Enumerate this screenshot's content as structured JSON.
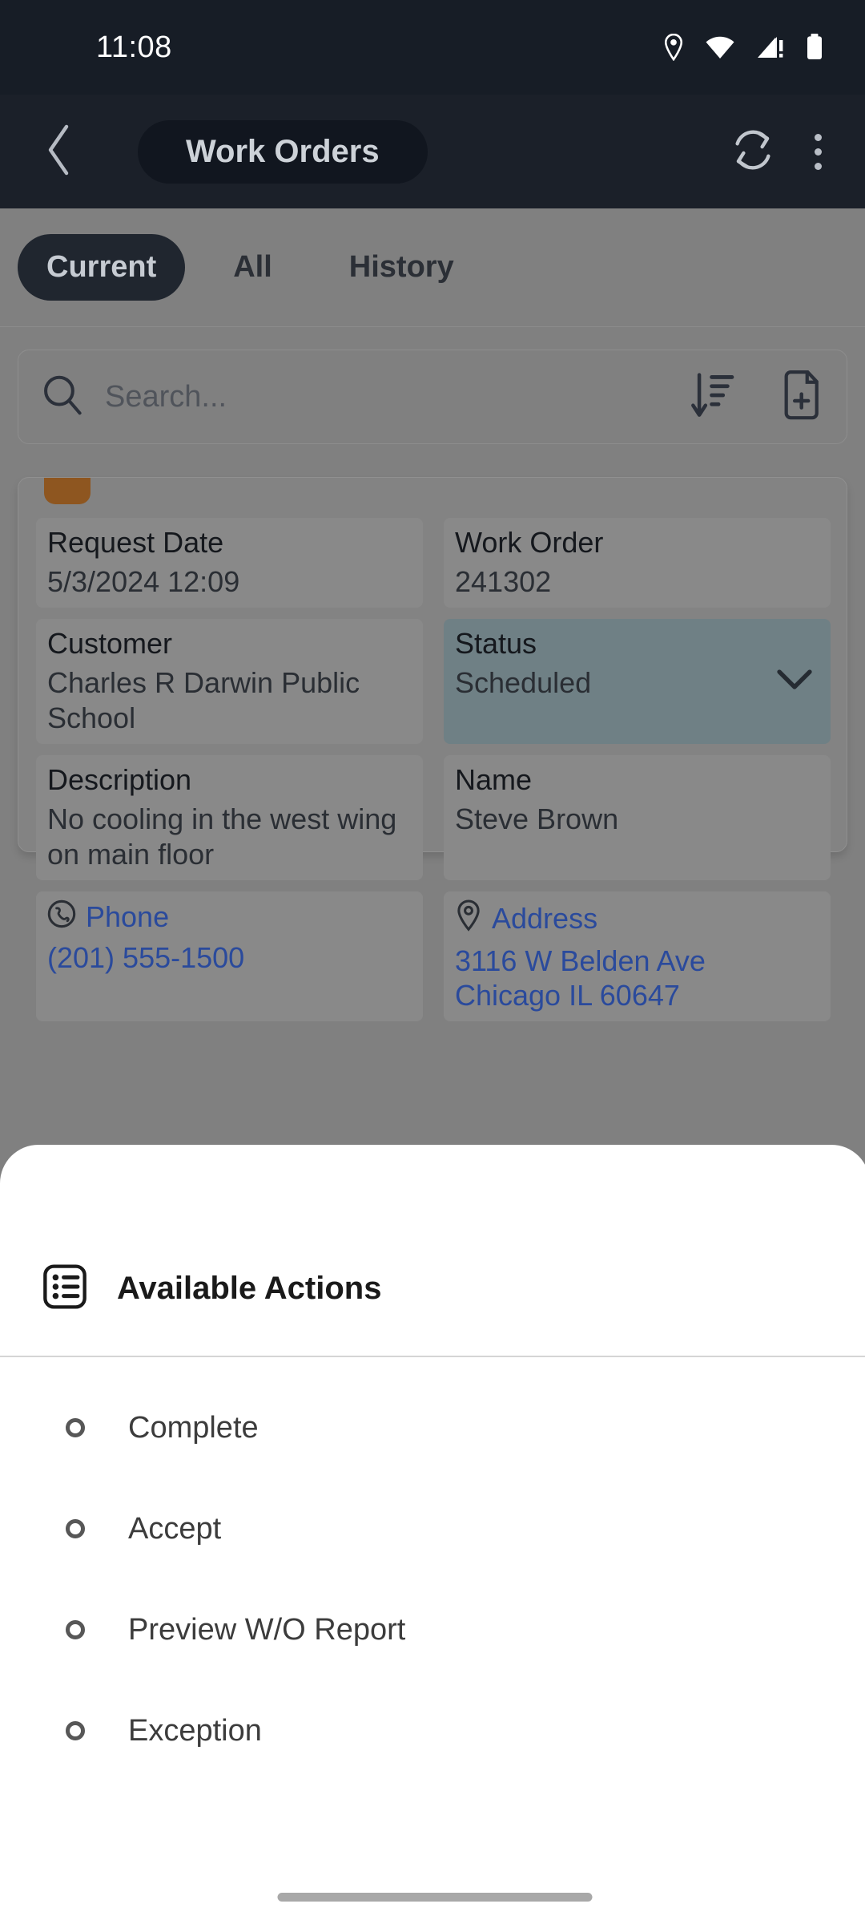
{
  "status_bar": {
    "time": "11:08",
    "icons": [
      "location-pin-icon",
      "wifi-icon",
      "cellular-alert-icon",
      "battery-icon"
    ]
  },
  "app_bar": {
    "back_icon": "chevron-left-icon",
    "title": "Work Orders",
    "refresh_icon": "sync-refresh-icon",
    "overflow_icon": "more-vertical-icon"
  },
  "tabs": [
    {
      "label": "Current",
      "selected": true
    },
    {
      "label": "All",
      "selected": false
    },
    {
      "label": "History",
      "selected": false
    }
  ],
  "search": {
    "placeholder": "Search...",
    "search_icon": "search-icon",
    "sort_icon": "sort-descending-icon",
    "new_icon": "file-plus-icon"
  },
  "work_order_card": {
    "bookmark_color": "#8e5620",
    "fields": {
      "request_date_label": "Request Date",
      "request_date_value": "5/3/2024 12:09",
      "work_order_label": "Work Order",
      "work_order_value": "241302",
      "customer_label": "Customer",
      "customer_value": "Charles R Darwin Public School",
      "status_label": "Status",
      "status_value": "Scheduled",
      "status_chevron_icon": "chevron-down-icon",
      "description_label": "Description",
      "description_value": "No cooling in the west wing on main floor",
      "name_label": "Name",
      "name_value": "Steve Brown",
      "phone_label": "Phone",
      "phone_icon": "phone-circle-icon",
      "phone_value": "(201) 555-1500",
      "address_label": "Address",
      "address_icon": "map-pin-icon",
      "address_line1": "3116 W Belden Ave",
      "address_line2": "Chicago IL 60647"
    },
    "link_color": "#2a4a9c"
  },
  "bottom_sheet": {
    "icon": "list-box-icon",
    "title": "Available Actions",
    "actions": [
      {
        "label": "Complete"
      },
      {
        "label": "Accept"
      },
      {
        "label": "Preview W/O Report"
      },
      {
        "label": "Exception"
      }
    ]
  }
}
